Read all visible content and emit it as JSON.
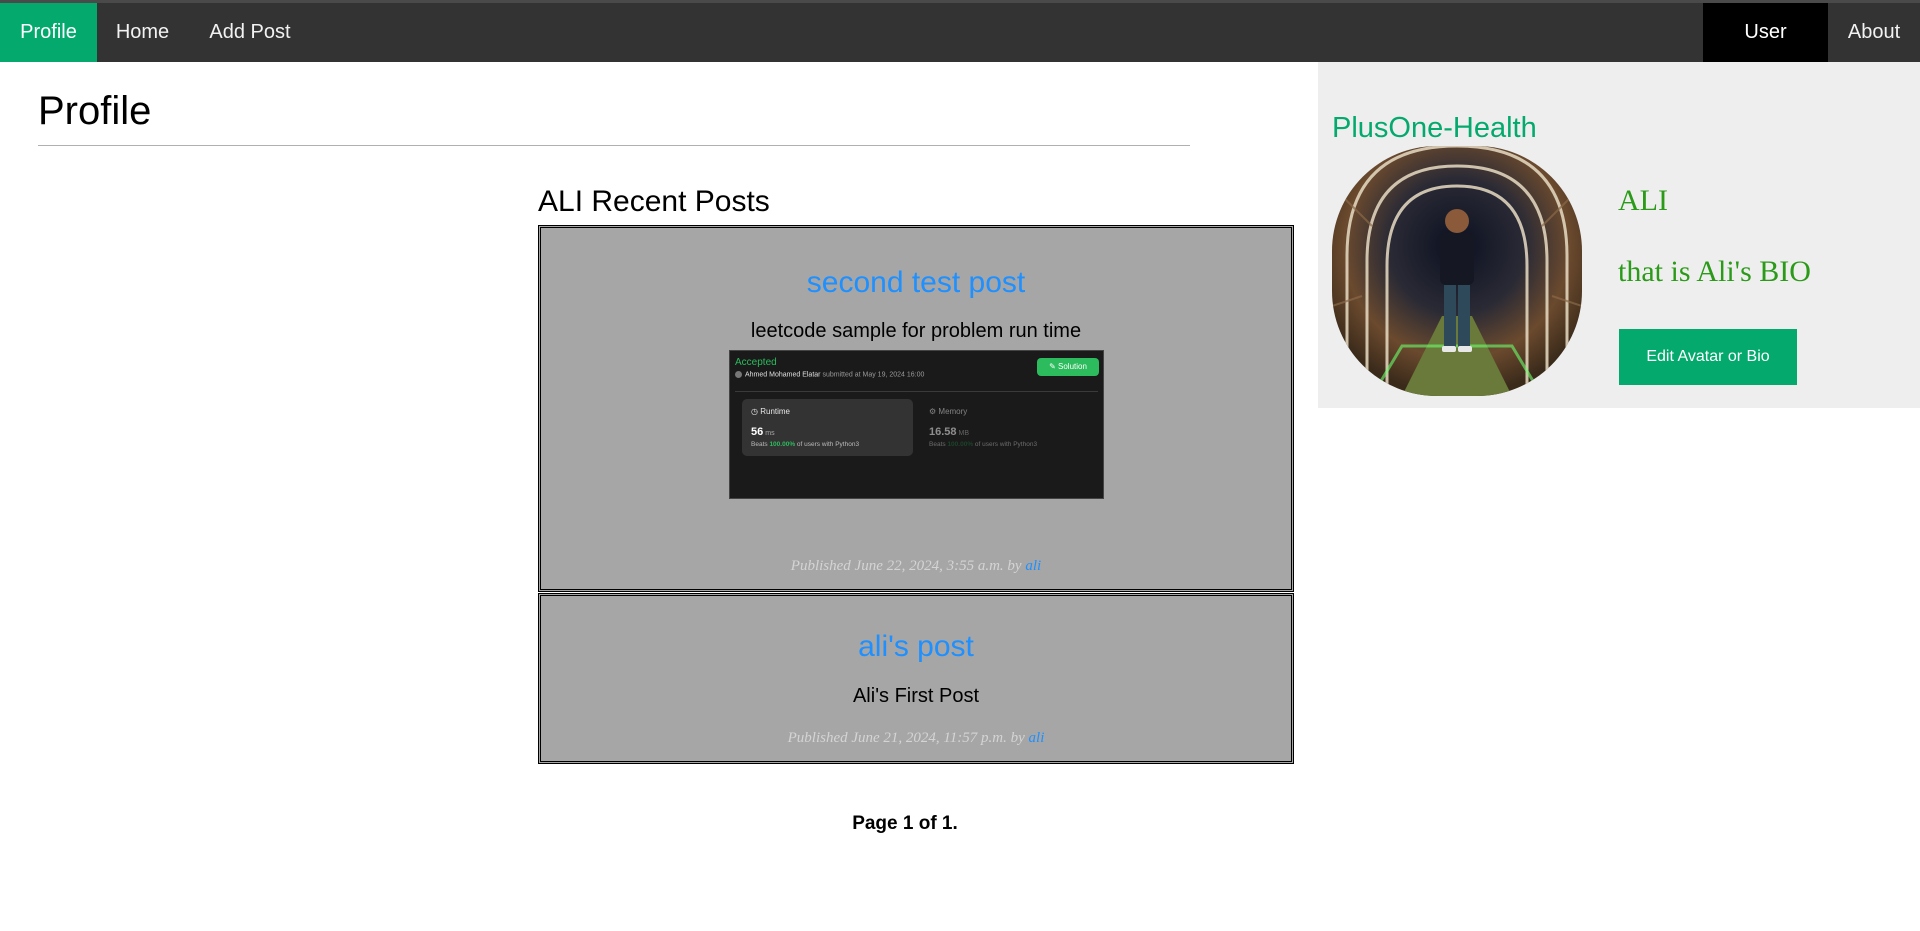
{
  "nav": {
    "profile": "Profile",
    "home": "Home",
    "add_post": "Add Post",
    "user": "User",
    "about": "About",
    "active_color": "#04AA6D"
  },
  "page": {
    "title": "Profile",
    "posts_heading": "ALI Recent Posts",
    "pagination": "Page 1 of 1."
  },
  "posts": [
    {
      "title": "second test post",
      "body": "leetcode sample for problem run time",
      "meta_prefix": "Published June 22, 2024, 3:55 a.m. by ",
      "author": "ali",
      "image": {
        "status": "Accepted",
        "submitter": "Ahmed Mohamed Elatar",
        "submitted_text": "submitted at May 19, 2024 16:00",
        "solution_label": "Solution",
        "runtime_label": "Runtime",
        "runtime_value": "56",
        "runtime_unit": "ms",
        "runtime_beats_prefix": "Beats",
        "runtime_beats_pct": "100.00%",
        "runtime_beats_suffix": "of users with Python3",
        "memory_label": "Memory",
        "memory_value": "16.58",
        "memory_unit": "MB",
        "memory_beats_prefix": "Beats",
        "memory_beats_pct": "100.00%",
        "memory_beats_suffix": "of users with Python3"
      }
    },
    {
      "title": "ali's post",
      "body": "Ali's First Post",
      "meta_prefix": "Published June 21, 2024, 11:57 p.m. by ",
      "author": "ali"
    }
  ],
  "sidebar": {
    "site_name": "PlusOne-Health",
    "name": "ALI",
    "bio": "that is Ali's BIO",
    "edit_button": "Edit Avatar or Bio",
    "accent": "#04AA6D",
    "text_color": "#2a9a18"
  }
}
